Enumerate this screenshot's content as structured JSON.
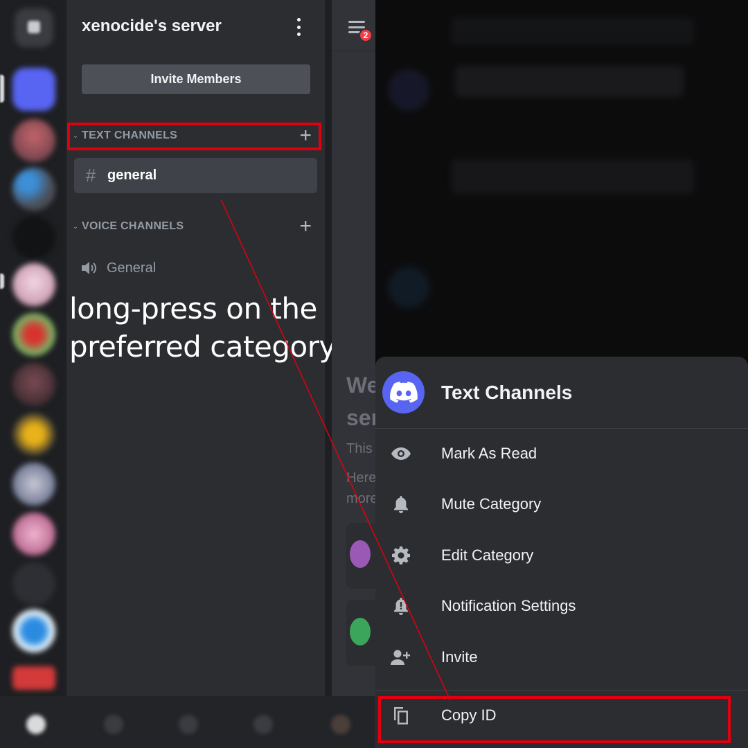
{
  "server": {
    "name": "xenocide's server",
    "invite_label": "Invite Members"
  },
  "categories": {
    "text_label": "TEXT CHANNELS",
    "voice_label": "VOICE CHANNELS"
  },
  "channels": {
    "text": [
      {
        "name": "general"
      }
    ],
    "voice": [
      {
        "name": "General"
      }
    ]
  },
  "chat": {
    "menu_badge": "2",
    "welcome_fragment_1": "We",
    "welcome_fragment_2": "ser",
    "sub_fragment_1": "This",
    "sub_fragment_2": "Here",
    "sub_fragment_3": "more"
  },
  "instruction": {
    "line1": "long-press on the",
    "line2": "preferred category"
  },
  "context_menu": {
    "title": "Text Channels",
    "items": [
      {
        "label": "Mark As Read",
        "icon": "eye-icon"
      },
      {
        "label": "Mute Category",
        "icon": "bell-icon"
      },
      {
        "label": "Edit Category",
        "icon": "gear-icon"
      },
      {
        "label": "Notification Settings",
        "icon": "bell-alert-icon"
      },
      {
        "label": "Invite",
        "icon": "add-person-icon"
      },
      {
        "label": "Copy ID",
        "icon": "copy-icon"
      }
    ]
  },
  "colors": {
    "highlight": "#e1000f",
    "brand": "#5865f2",
    "panel": "#2b2d31"
  }
}
